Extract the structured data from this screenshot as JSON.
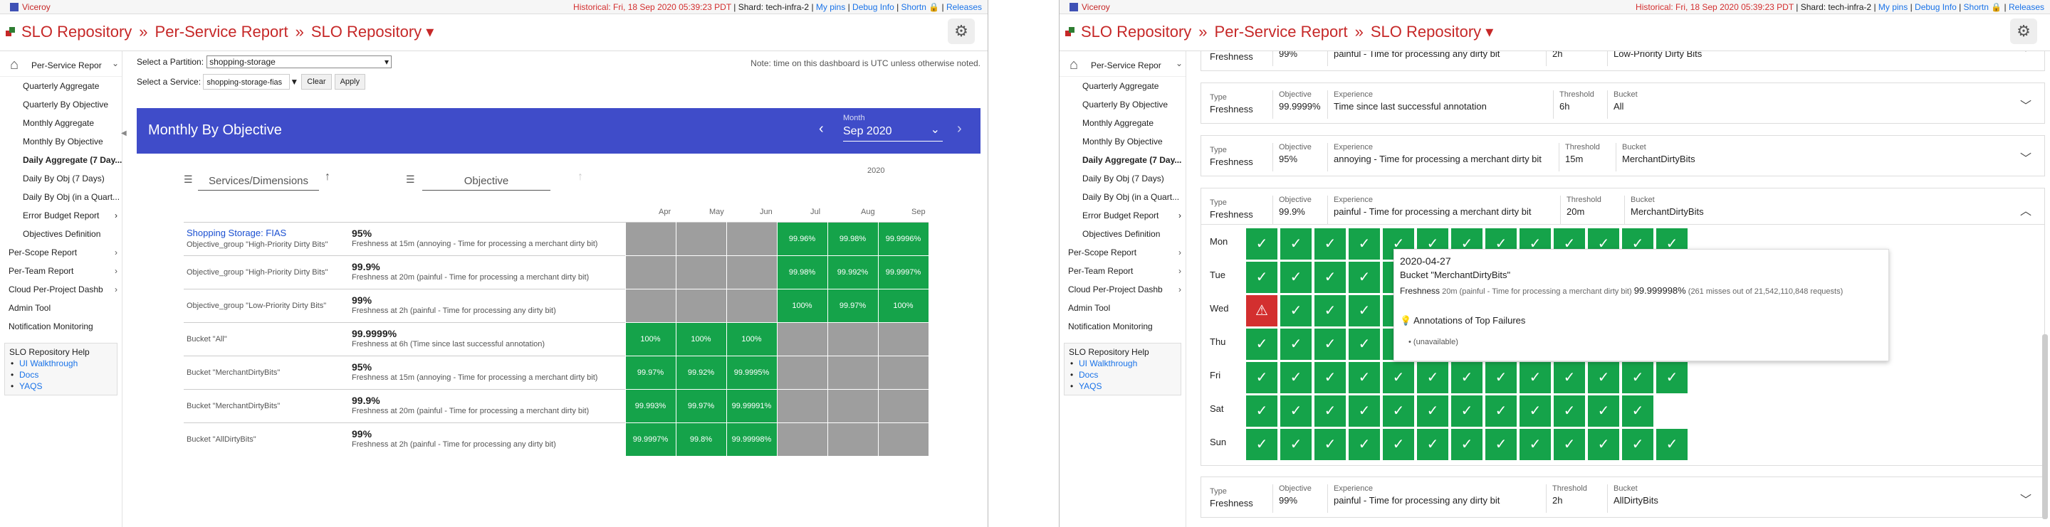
{
  "topbar": {
    "app_name": "Viceroy",
    "historical": "Historical: Fri, 18 Sep 2020 05:39:23 PDT",
    "shard": " | Shard: tech-infra-2 | ",
    "links": [
      "My pins",
      "Debug Info",
      "Shortn",
      "Releases"
    ]
  },
  "breadcrumb": [
    "SLO Repository",
    "»",
    "Per-Service Report",
    "»",
    "SLO Repository",
    "▾"
  ],
  "sidebar": {
    "top": "Per-Service Repor",
    "items": [
      "Quarterly Aggregate",
      "Quarterly By Objective",
      "Monthly Aggregate",
      "Monthly By Objective",
      "Daily Aggregate (7 Day...",
      "Daily By Obj (7 Days)",
      "Daily By Obj (in a Quart...",
      "Error Budget Report",
      "Objectives Definition"
    ],
    "sections": [
      "Per-Scope Report",
      "Per-Team Report",
      "Cloud Per-Project Dashb",
      "Admin Tool",
      "Notification Monitoring"
    ],
    "help_title": "SLO Repository Help",
    "help_links": [
      "UI Walkthrough",
      "Docs",
      "YAQS"
    ]
  },
  "controls": {
    "partition_label": "Select a Partition:",
    "partition_value": "shopping-storage",
    "service_label": "Select a Service:",
    "service_value": "shopping-storage-fias",
    "clear": "Clear",
    "apply": "Apply",
    "note": "Note: time on this dashboard is UTC unless otherwise noted."
  },
  "banner": {
    "title": "Monthly By Objective",
    "month_label": "Month",
    "month_value": "Sep 2020"
  },
  "table": {
    "col_services": "Services/Dimensions",
    "col_objective": "Objective",
    "year": "2020",
    "months": [
      "Apr",
      "May",
      "Jun",
      "Jul",
      "Aug",
      "Sep"
    ],
    "rows": [
      {
        "svc": "Shopping Storage: FIAS",
        "svc2": "Objective_group \"High-Priority Dirty Bits\"",
        "obj": "95%",
        "desc": "Freshness at 15m (annoying - Time for processing a merchant dirty bit)",
        "cells": [
          "",
          "",
          "",
          "99.96%",
          "99.98%",
          "99.9996%"
        ]
      },
      {
        "svc": "",
        "svc2": "Objective_group \"High-Priority Dirty Bits\"",
        "obj": "99.9%",
        "desc": "Freshness at 20m (painful - Time for processing a merchant dirty bit)",
        "cells": [
          "",
          "",
          "",
          "99.98%",
          "99.992%",
          "99.9997%"
        ]
      },
      {
        "svc": "",
        "svc2": "Objective_group \"Low-Priority Dirty Bits\"",
        "obj": "99%",
        "desc": "Freshness at 2h (painful - Time for processing any dirty bit)",
        "cells": [
          "",
          "",
          "",
          "100%",
          "99.97%",
          "100%"
        ]
      },
      {
        "svc": "",
        "svc2": "Bucket \"All\"",
        "obj": "99.9999%",
        "desc": "Freshness at 6h (Time since last successful annotation)",
        "cells": [
          "100%",
          "100%",
          "100%",
          "",
          "",
          ""
        ]
      },
      {
        "svc": "",
        "svc2": "Bucket \"MerchantDirtyBits\"",
        "obj": "95%",
        "desc": "Freshness at 15m (annoying - Time for processing a merchant dirty bit)",
        "cells": [
          "99.97%",
          "99.92%",
          "99.9995%",
          "",
          "",
          ""
        ]
      },
      {
        "svc": "",
        "svc2": "Bucket \"MerchantDirtyBits\"",
        "obj": "99.9%",
        "desc": "Freshness at 20m (painful - Time for processing a merchant dirty bit)",
        "cells": [
          "99.993%",
          "99.97%",
          "99.99991%",
          "",
          "",
          ""
        ]
      },
      {
        "svc": "",
        "svc2": "Bucket \"AllDirtyBits\"",
        "obj": "99%",
        "desc": "Freshness at 2h (painful - Time for processing any dirty bit)",
        "cells": [
          "99.9997%",
          "99.8%",
          "99.99998%",
          "",
          "",
          ""
        ]
      }
    ]
  },
  "labels": {
    "type": "Type",
    "objective": "Objective",
    "experience": "Experience",
    "threshold": "Threshold",
    "bucket": "Bucket",
    "objective_group": "Objective_group"
  },
  "cards": [
    {
      "type": "Freshness",
      "objective": "99%",
      "experience": "painful - Time for processing any dirty bit",
      "threshold": "2h",
      "bucket_label": "Objective_group",
      "bucket": "Low-Priority Dirty Bits"
    },
    {
      "type": "Freshness",
      "objective": "99.9999%",
      "experience": "Time since last successful annotation",
      "threshold": "6h",
      "bucket_label": "Bucket",
      "bucket": "All"
    },
    {
      "type": "Freshness",
      "objective": "95%",
      "experience": "annoying - Time for processing a merchant dirty bit",
      "threshold": "15m",
      "bucket_label": "Bucket",
      "bucket": "MerchantDirtyBits"
    },
    {
      "type": "Freshness",
      "objective": "99.9%",
      "experience": "painful - Time for processing a merchant dirty bit",
      "threshold": "20m",
      "bucket_label": "Bucket",
      "bucket": "MerchantDirtyBits"
    },
    {
      "type": "Freshness",
      "objective": "99%",
      "experience": "painful - Time for processing any dirty bit",
      "threshold": "2h",
      "bucket_label": "Bucket",
      "bucket": "AllDirtyBits"
    }
  ],
  "calendar": {
    "days": [
      "Mon",
      "Tue",
      "Wed",
      "Thu",
      "Fri",
      "Sat",
      "Sun"
    ]
  },
  "tooltip": {
    "date": "2020-04-27",
    "bucket": "Bucket \"MerchantDirtyBits\"",
    "line_a": "Freshness",
    "line_b": " 20m (painful - Time for processing a merchant dirty bit) ",
    "line_c": "99.999998%",
    "line_d": " (261 misses out of 21,542,110,848 requests)",
    "ann_title": "Annotations of Top Failures",
    "ann_item": "(unavailable)"
  },
  "colors": {
    "accent": "#c62828",
    "banner": "#3f4cc9",
    "good": "#15a34a",
    "bad": "#d32f2f",
    "none": "#9e9e9e"
  }
}
